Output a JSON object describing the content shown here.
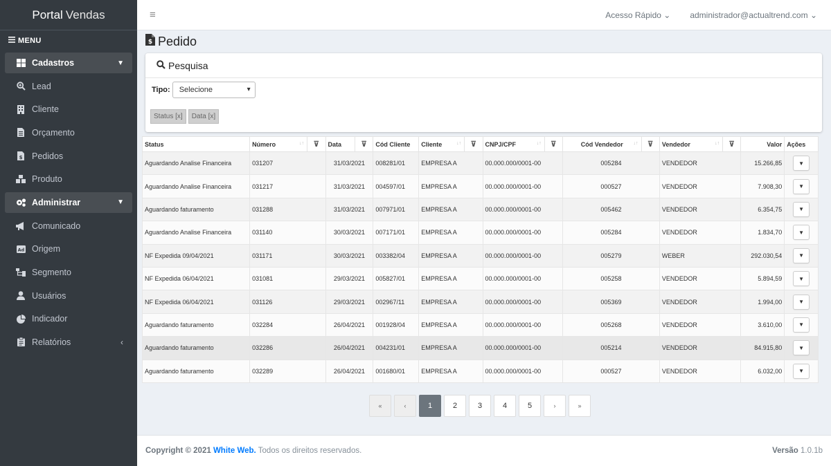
{
  "brand": {
    "part1": "Portal",
    "part2": "Vendas"
  },
  "menu_label": "MENU",
  "sidebar": {
    "items": [
      {
        "label": "Cadastros",
        "icon": "grid-icon",
        "type": "parent"
      },
      {
        "label": "Lead",
        "icon": "search-plus-icon"
      },
      {
        "label": "Cliente",
        "icon": "building-icon"
      },
      {
        "label": "Orçamento",
        "icon": "file-text-icon"
      },
      {
        "label": "Pedidos",
        "icon": "file-invoice-icon"
      },
      {
        "label": "Produto",
        "icon": "cubes-icon"
      },
      {
        "label": "Administrar",
        "icon": "cogs-icon",
        "type": "parent"
      },
      {
        "label": "Comunicado",
        "icon": "bullhorn-icon"
      },
      {
        "label": "Origem",
        "icon": "ad-icon"
      },
      {
        "label": "Segmento",
        "icon": "sitemap-icon"
      },
      {
        "label": "Usuários",
        "icon": "user-icon"
      },
      {
        "label": "Indicador",
        "icon": "chart-pie-icon"
      },
      {
        "label": "Relatórios",
        "icon": "clipboard-icon"
      }
    ]
  },
  "topbar": {
    "quick_access": "Acesso Rápido",
    "user": "administrador@actualtrend.com"
  },
  "page": {
    "title": "Pedido"
  },
  "search": {
    "title": "Pesquisa",
    "tipo_label": "Tipo:",
    "tipo_value": "Selecione",
    "tags": [
      "Status [x]",
      "Data [x]"
    ]
  },
  "table": {
    "headers": {
      "status": "Status",
      "numero": "Número",
      "data": "Data",
      "cod_cliente": "Cód Cliente",
      "cliente": "Cliente",
      "cnpj": "CNPJ/CPF",
      "cod_vendedor": "Cód Vendedor",
      "vendedor": "Vendedor",
      "valor": "Valor",
      "acoes": "Ações"
    },
    "rows": [
      {
        "status": "Aguardando Analise Financeira",
        "numero": "031207",
        "data": "31/03/2021",
        "cod_cliente": "008281/01",
        "cliente": "EMPRESA A",
        "cnpj": "00.000.000/0001-00",
        "cod_vendedor": "005284",
        "vendedor": "VENDEDOR",
        "valor": "15.266,85"
      },
      {
        "status": "Aguardando Analise Financeira",
        "numero": "031217",
        "data": "31/03/2021",
        "cod_cliente": "004597/01",
        "cliente": "EMPRESA A",
        "cnpj": "00.000.000/0001-00",
        "cod_vendedor": "000527",
        "vendedor": "VENDEDOR",
        "valor": "7.908,30"
      },
      {
        "status": "Aguardando faturamento",
        "numero": "031288",
        "data": "31/03/2021",
        "cod_cliente": "007971/01",
        "cliente": "EMPRESA A",
        "cnpj": "00.000.000/0001-00",
        "cod_vendedor": "005462",
        "vendedor": "VENDEDOR",
        "valor": "6.354,75"
      },
      {
        "status": "Aguardando Analise Financeira",
        "numero": "031140",
        "data": "30/03/2021",
        "cod_cliente": "007171/01",
        "cliente": "EMPRESA A",
        "cnpj": "00.000.000/0001-00",
        "cod_vendedor": "005284",
        "vendedor": "VENDEDOR",
        "valor": "1.834,70"
      },
      {
        "status": "NF Expedida 09/04/2021",
        "numero": "031171",
        "data": "30/03/2021",
        "cod_cliente": "003382/04",
        "cliente": "EMPRESA A",
        "cnpj": "00.000.000/0001-00",
        "cod_vendedor": "005279",
        "vendedor": "WEBER",
        "valor": "292.030,54"
      },
      {
        "status": "NF Expedida 06/04/2021",
        "numero": "031081",
        "data": "29/03/2021",
        "cod_cliente": "005827/01",
        "cliente": "EMPRESA A",
        "cnpj": "00.000.000/0001-00",
        "cod_vendedor": "005258",
        "vendedor": "VENDEDOR",
        "valor": "5.894,59"
      },
      {
        "status": "NF Expedida 06/04/2021",
        "numero": "031126",
        "data": "29/03/2021",
        "cod_cliente": "002967/11",
        "cliente": "EMPRESA A",
        "cnpj": "00.000.000/0001-00",
        "cod_vendedor": "005369",
        "vendedor": "VENDEDOR",
        "valor": "1.994,00"
      },
      {
        "status": "Aguardando faturamento",
        "numero": "032284",
        "data": "26/04/2021",
        "cod_cliente": "001928/04",
        "cliente": "EMPRESA A",
        "cnpj": "00.000.000/0001-00",
        "cod_vendedor": "005268",
        "vendedor": "VENDEDOR",
        "valor": "3.610,00"
      },
      {
        "status": "Aguardando faturamento",
        "numero": "032286",
        "data": "26/04/2021",
        "cod_cliente": "004231/01",
        "cliente": "EMPRESA A",
        "cnpj": "00.000.000/0001-00",
        "cod_vendedor": "005214",
        "vendedor": "VENDEDOR",
        "valor": "84.915,80"
      },
      {
        "status": "Aguardando faturamento",
        "numero": "032289",
        "data": "26/04/2021",
        "cod_cliente": "001680/01",
        "cliente": "EMPRESA A",
        "cnpj": "00.000.000/0001-00",
        "cod_vendedor": "000527",
        "vendedor": "VENDEDOR",
        "valor": "6.032,00"
      }
    ]
  },
  "pagination": {
    "first": "«",
    "prev": "‹",
    "pages": [
      "1",
      "2",
      "3",
      "4",
      "5"
    ],
    "next": "›",
    "last": "»",
    "active": "1"
  },
  "footer": {
    "copyright": "Copyright © 2021",
    "brand": "White Web.",
    "rights": "Todos os direitos reservados.",
    "version_label": "Versão",
    "version": "1.0.1b"
  }
}
